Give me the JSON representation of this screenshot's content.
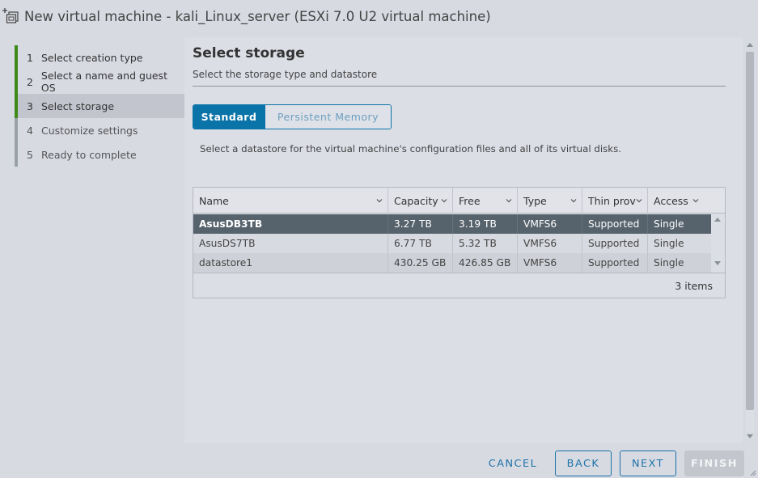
{
  "window": {
    "title": "New virtual machine - kali_Linux_server (ESXi 7.0 U2 virtual machine)"
  },
  "nav": {
    "steps": [
      {
        "num": "1",
        "label": "Select creation type",
        "state": "done"
      },
      {
        "num": "2",
        "label": "Select a name and guest OS",
        "state": "done"
      },
      {
        "num": "3",
        "label": "Select storage",
        "state": "active"
      },
      {
        "num": "4",
        "label": "Customize settings",
        "state": "future"
      },
      {
        "num": "5",
        "label": "Ready to complete",
        "state": "future"
      }
    ]
  },
  "main": {
    "title": "Select storage",
    "subtitle": "Select the storage type and datastore",
    "segments": {
      "standard": "Standard",
      "persistent": "Persistent Memory",
      "selected": "Standard"
    },
    "description": "Select a datastore for the virtual machine's configuration files and all of its virtual disks."
  },
  "table": {
    "columns": [
      "Name",
      "Capacity",
      "Free",
      "Type",
      "Thin provisioning",
      "Access"
    ],
    "rows": [
      {
        "name": "AsusDB3TB",
        "capacity": "3.27 TB",
        "free": "3.19 TB",
        "type": "VMFS6",
        "thin": "Supported",
        "access": "Single",
        "selected": true
      },
      {
        "name": "AsusDS7TB",
        "capacity": "6.77 TB",
        "free": "5.32 TB",
        "type": "VMFS6",
        "thin": "Supported",
        "access": "Single",
        "selected": false
      },
      {
        "name": "datastore1",
        "capacity": "430.25 GB",
        "free": "426.85 GB",
        "type": "VMFS6",
        "thin": "Supported",
        "access": "Single",
        "selected": false
      }
    ],
    "item_count": "3 items"
  },
  "footer": {
    "cancel": "CANCEL",
    "back": "BACK",
    "next": "NEXT",
    "finish": "FINISH"
  },
  "colors": {
    "accent": "#0a73a8",
    "done_step": "#3c8a18",
    "selected_row": "#56626c"
  }
}
